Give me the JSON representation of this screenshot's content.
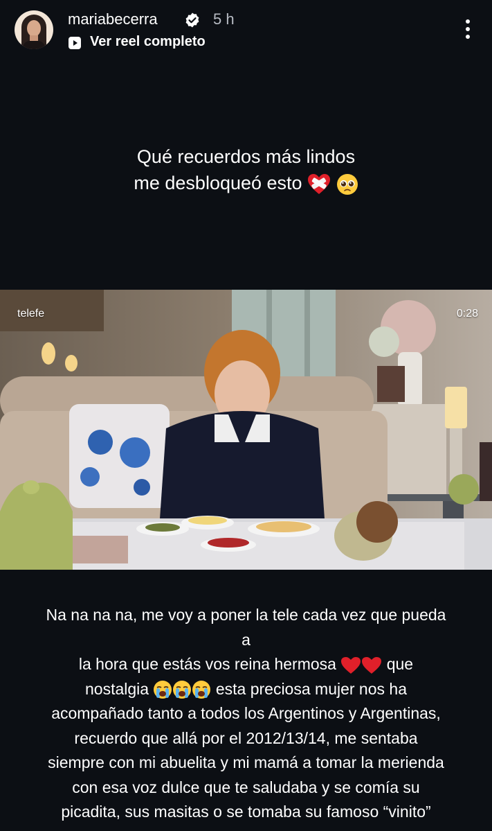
{
  "header": {
    "username": "mariabecerra",
    "time": "5 h",
    "reel_link": "Ver reel completo"
  },
  "caption_top": {
    "line1": "Qué recuerdos más lindos",
    "line2": "me desbloqueó esto"
  },
  "video": {
    "channel": "telefe",
    "duration": "0:28"
  },
  "caption_bottom": {
    "line1": "Na na na na, me voy a poner la tele cada vez que pueda a",
    "line2_a": "la hora que estás vos reina hermosa",
    "line2_b": " que",
    "line3_a": "nostalgia",
    "line3_b": " esta preciosa mujer nos ha",
    "line4": "acompañado tanto a todos los Argentinos y Argentinas,",
    "line5": "recuerdo  que allá por el 2012/13/14, me sentaba",
    "line6": "siempre con mi abuelita y mi mamá a tomar la merienda",
    "line7": "con esa voz dulce que te saludaba y se comía su",
    "line8": "picadita, sus masitas o se tomaba su famoso “vinito”"
  },
  "icons": [
    "avatar",
    "verified-badge-icon",
    "reel-play-icon",
    "more-options-icon",
    "mending-heart-emoji",
    "pleading-face-emoji",
    "red-heart-emoji",
    "crying-face-emoji"
  ],
  "colors": {
    "background": "#0c0f14",
    "muted_text": "#b8bcc4",
    "heart": "#e0202a"
  }
}
